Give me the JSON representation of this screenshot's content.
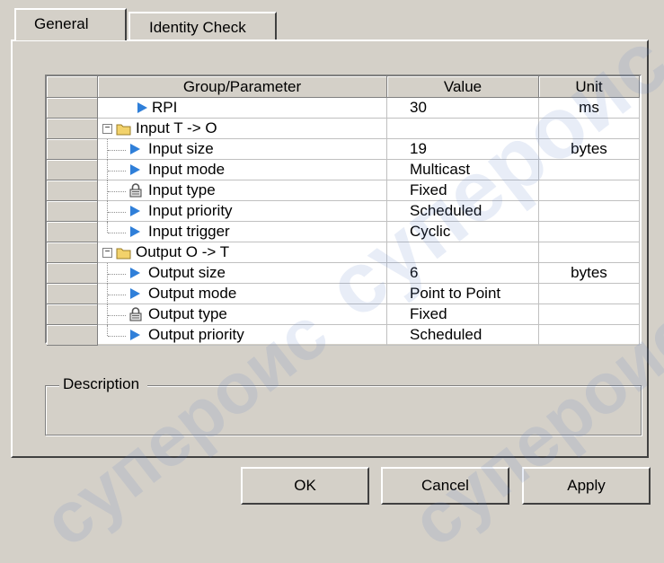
{
  "tabs": [
    {
      "label": "General",
      "active": true
    },
    {
      "label": "Identity Check",
      "active": false
    }
  ],
  "grid": {
    "columns": [
      "Group/Parameter",
      "Value",
      "Unit"
    ],
    "rows": [
      {
        "type": "param",
        "icon": "arrow-icon",
        "name": "RPI",
        "value": "30",
        "unit": "ms",
        "level": 0
      },
      {
        "type": "group",
        "name": "Input T -> O",
        "value": "",
        "unit": ""
      },
      {
        "type": "param",
        "icon": "arrow-icon",
        "name": "Input size",
        "value": "19",
        "unit": "bytes",
        "level": 1
      },
      {
        "type": "param",
        "icon": "arrow-icon",
        "name": "Input mode",
        "value": "Multicast",
        "unit": "",
        "level": 1
      },
      {
        "type": "param",
        "icon": "lock-icon",
        "name": "Input type",
        "value": "Fixed",
        "unit": "",
        "level": 1
      },
      {
        "type": "param",
        "icon": "arrow-icon",
        "name": "Input priority",
        "value": "Scheduled",
        "unit": "",
        "level": 1
      },
      {
        "type": "param",
        "icon": "arrow-icon",
        "name": "Input trigger",
        "value": "Cyclic",
        "unit": "",
        "level": 1
      },
      {
        "type": "group",
        "name": "Output O -> T",
        "value": "",
        "unit": ""
      },
      {
        "type": "param",
        "icon": "arrow-icon",
        "name": "Output size",
        "value": "6",
        "unit": "bytes",
        "level": 1
      },
      {
        "type": "param",
        "icon": "arrow-icon",
        "name": "Output mode",
        "value": "Point to Point",
        "unit": "",
        "level": 1
      },
      {
        "type": "param",
        "icon": "lock-icon",
        "name": "Output type",
        "value": "Fixed",
        "unit": "",
        "level": 1
      },
      {
        "type": "param",
        "icon": "arrow-icon",
        "name": "Output priority",
        "value": "Scheduled",
        "unit": "",
        "level": 1
      }
    ]
  },
  "description": {
    "label": "Description",
    "text": ""
  },
  "buttons": {
    "ok": "OK",
    "cancel": "Cancel",
    "apply": "Apply"
  },
  "watermark": "супероис",
  "colors": {
    "face": "#d4d0c8",
    "arrow": "#2f7fd9",
    "folder": "#f2d26b"
  }
}
